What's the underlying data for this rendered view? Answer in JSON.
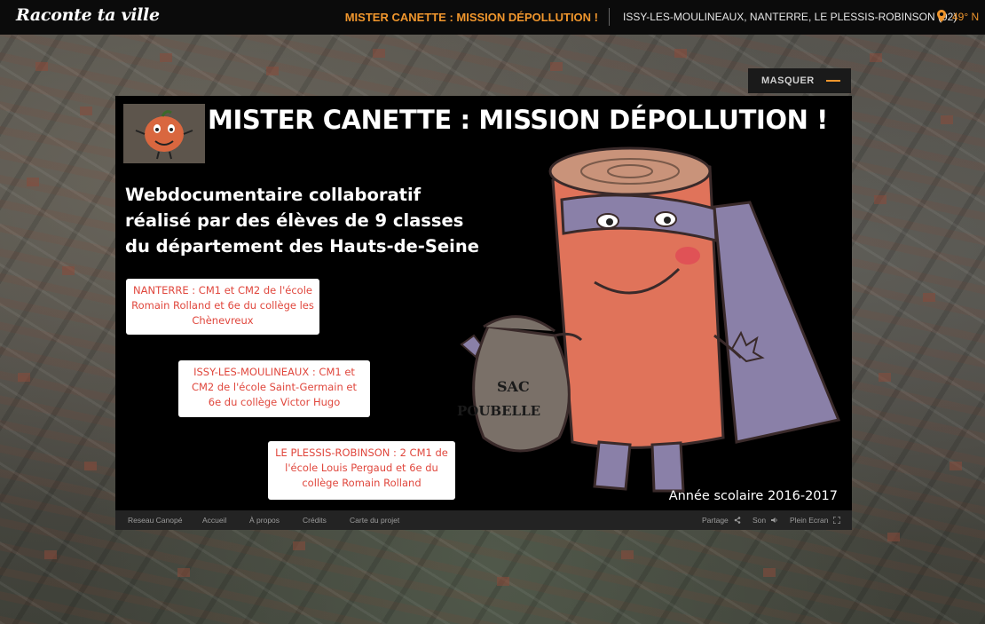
{
  "topbar": {
    "logo": "Raconte ta ville",
    "title": "MISTER CANETTE : MISSION DÉPOLLUTION !",
    "places": "ISSY-LES-MOULINEAUX, NANTERRE, LE PLESSIS-ROBINSON (92)",
    "coords": "49° N",
    "pin_icon": "map-pin-icon"
  },
  "overlay": {
    "masquer_label": "MASQUER"
  },
  "panel": {
    "title": "MISTER CANETTE : MISSION DÉPOLLUTION !",
    "subtitle": [
      "Webdocumentaire collaboratif",
      "réalisé par des élèves de 9 classes",
      "du département des Hauts-de-Seine"
    ],
    "cards": [
      {
        "text": "NANTERRE : CM1 et CM2 de l'école Romain Rolland et 6e du collège les Chènevreux"
      },
      {
        "text": "ISSY-LES-MOULINEAUX : CM1 et CM2 de l'école Saint-Germain et 6e du collège Victor Hugo"
      },
      {
        "text": "LE PLESSIS-ROBINSON : 2 CM1 de l'école Louis Pergaud et 6e du collège Romain Rolland"
      }
    ],
    "drawing_bag_text": [
      "SAC",
      "POUBELLE"
    ],
    "year": "Année scolaire 2016-2017"
  },
  "footer": {
    "links": [
      "Reseau Canopé",
      "Accueil",
      "À propos",
      "Crédits",
      "Carte du projet"
    ],
    "share": "Partage",
    "sound": "Son",
    "fullscreen": "Plein Ecran"
  },
  "colors": {
    "accent": "#f0962d",
    "card_text": "#e0473d",
    "panel_bg": "#000000",
    "topbar_bg": "#0b0b0b"
  }
}
